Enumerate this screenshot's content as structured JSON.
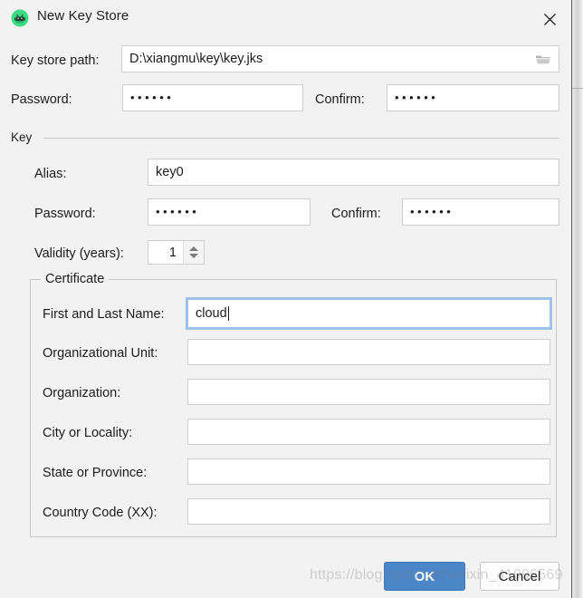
{
  "window": {
    "title": "New Key Store",
    "app_icon": "android-studio-icon",
    "close_icon": "close-icon",
    "accent_color": "#4a86c8",
    "focus_color": "#9cc2e8",
    "background_color": "#f2f2f2"
  },
  "keystore": {
    "path_label": "Key store path:",
    "path_value": "D:\\xiangmu\\key\\key.jks",
    "path_placeholder": "",
    "browse_icon": "folder-icon",
    "password_label": "Password:",
    "password_value": "••••••",
    "confirm_label": "Confirm:",
    "confirm_value": "••••••"
  },
  "key_group": {
    "legend": "Key",
    "alias_label": "Alias:",
    "alias_value": "key0",
    "password_label": "Password:",
    "password_value": "••••••",
    "confirm_label": "Confirm:",
    "confirm_value": "••••••",
    "validity_label": "Validity (years):",
    "validity_value": "1",
    "spinner_up_icon": "chevron-up-icon",
    "spinner_down_icon": "chevron-down-icon"
  },
  "certificate": {
    "legend": "Certificate",
    "fields": [
      {
        "label": "First and Last Name:",
        "value": "cloud",
        "focused": true
      },
      {
        "label": "Organizational Unit:",
        "value": "",
        "focused": false
      },
      {
        "label": "Organization:",
        "value": "",
        "focused": false
      },
      {
        "label": "City or Locality:",
        "value": "",
        "focused": false
      },
      {
        "label": "State or Province:",
        "value": "",
        "focused": false
      },
      {
        "label": "Country Code (XX):",
        "value": "",
        "focused": false
      }
    ]
  },
  "footer": {
    "ok_label": "OK",
    "cancel_label": "Cancel"
  },
  "watermark": {
    "text": "https://blog.csdn.net/weixin_41096569"
  }
}
